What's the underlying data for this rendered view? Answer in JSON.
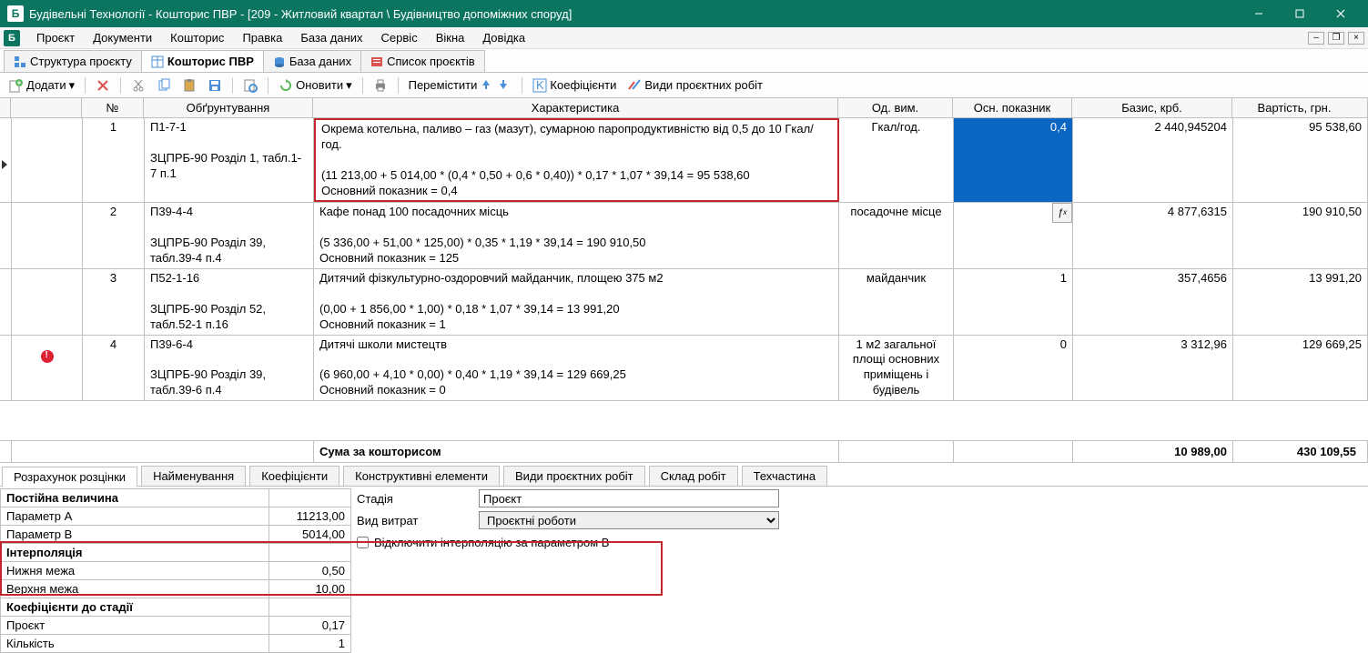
{
  "window": {
    "title": "Будівельні Технології - Кошторис ПВР - [209 - Житловий квартал \\ Будівництво допоміжних споруд]"
  },
  "menu": {
    "items": [
      "Проєкт",
      "Документи",
      "Кошторис",
      "Правка",
      "База даних",
      "Сервіс",
      "Вікна",
      "Довідка"
    ]
  },
  "doctabs": {
    "items": [
      {
        "label": "Структура проєкту"
      },
      {
        "label": "Кошторис ПВР"
      },
      {
        "label": "База даних"
      },
      {
        "label": "Список проєктів"
      }
    ]
  },
  "toolbar": {
    "add": "Додати",
    "refresh": "Оновити",
    "move": "Перемістити",
    "coef": "Коефіцієнти",
    "types": "Види проєктних робіт"
  },
  "table": {
    "headers": {
      "no": "№",
      "just": "Обґрунтування",
      "char": "Характеристика",
      "unit": "Од. вим.",
      "osn": "Осн. показник",
      "basis": "Базис, крб.",
      "cost": "Вартість, грн."
    },
    "rows": [
      {
        "no": "1",
        "just": "П1-7-1\n\nЗЦПРБ-90 Розділ 1, табл.1-7 п.1",
        "char": "Окрема котельна, паливо – газ (мазут), сумарною паропродуктивністю від 0,5 до 10 Гкал/год.\n\n(11 213,00 + 5 014,00 * (0,4 * 0,50 + 0,6 * 0,40)) * 0,17  * 1,07 * 39,14 = 95 538,60\nОсновний показник = 0,4",
        "unit": "Гкал/год.",
        "osn": "0,4",
        "basis": "2 440,945204",
        "cost": "95 538,60"
      },
      {
        "no": "2",
        "just": "П39-4-4\n\nЗЦПРБ-90 Розділ 39, табл.39-4 п.4",
        "char": "Кафе понад 100 посадочних місць\n\n(5 336,00 + 51,00 * 125,00) * 0,35  * 1,19 * 39,14 = 190 910,50\nОсновний показник = 125",
        "unit": "посадочне місце",
        "osn": "",
        "basis": "4 877,6315",
        "cost": "190 910,50"
      },
      {
        "no": "3",
        "just": "П52-1-16\n\nЗЦПРБ-90 Розділ 52, табл.52-1 п.16",
        "char": "Дитячий фізкультурно-оздоровчий майданчик, площею 375 м2\n\n(0,00 + 1 856,00 * 1,00) * 0,18  * 1,07 * 39,14 = 13 991,20\nОсновний показник = 1",
        "unit": "майданчик",
        "osn": "1",
        "basis": "357,4656",
        "cost": "13 991,20"
      },
      {
        "no": "4",
        "just": "П39-6-4\n\nЗЦПРБ-90 Розділ 39, табл.39-6 п.4",
        "char": "Дитячі школи мистецтв\n\n(6 960,00 + 4,10 * 0,00) * 0,40  * 1,19 * 39,14 = 129 669,25\nОсновний показник = 0",
        "unit": "1 м2 загальної площі основних приміщень і будівель",
        "osn": "0",
        "basis": "3 312,96",
        "cost": "129 669,25"
      }
    ],
    "summary": {
      "label": "Сума за кошторисом",
      "basis": "10 989,00",
      "cost": "430 109,55"
    }
  },
  "dtabs": {
    "items": [
      "Розрахунок розцінки",
      "Найменування",
      "Коефіцієнти",
      "Конструктивні елементи",
      "Види проєктних робіт",
      "Склад робіт",
      "Техчастина"
    ]
  },
  "detail": {
    "const_hdr": "Постійна величина",
    "paramA_l": "Параметр А",
    "paramA_v": "11213,00",
    "paramB_l": "Параметр B",
    "paramB_v": "5014,00",
    "interp_hdr": "Інтерполяція",
    "low_l": "Нижня межа",
    "low_v": "0,50",
    "high_l": "Верхня межа",
    "high_v": "10,00",
    "stage_hdr": "Коефіцієнти до стадії",
    "proj_l": "Проєкт",
    "proj_v": "0,17",
    "qty_l": "Кількість",
    "qty_v": "1",
    "stage_label": "Стадія",
    "stage_value": "Проєкт",
    "type_label": "Вид витрат",
    "type_value": "Проєктні роботи",
    "disable_interp": "Відключити інтерполяцію за параметром В"
  }
}
